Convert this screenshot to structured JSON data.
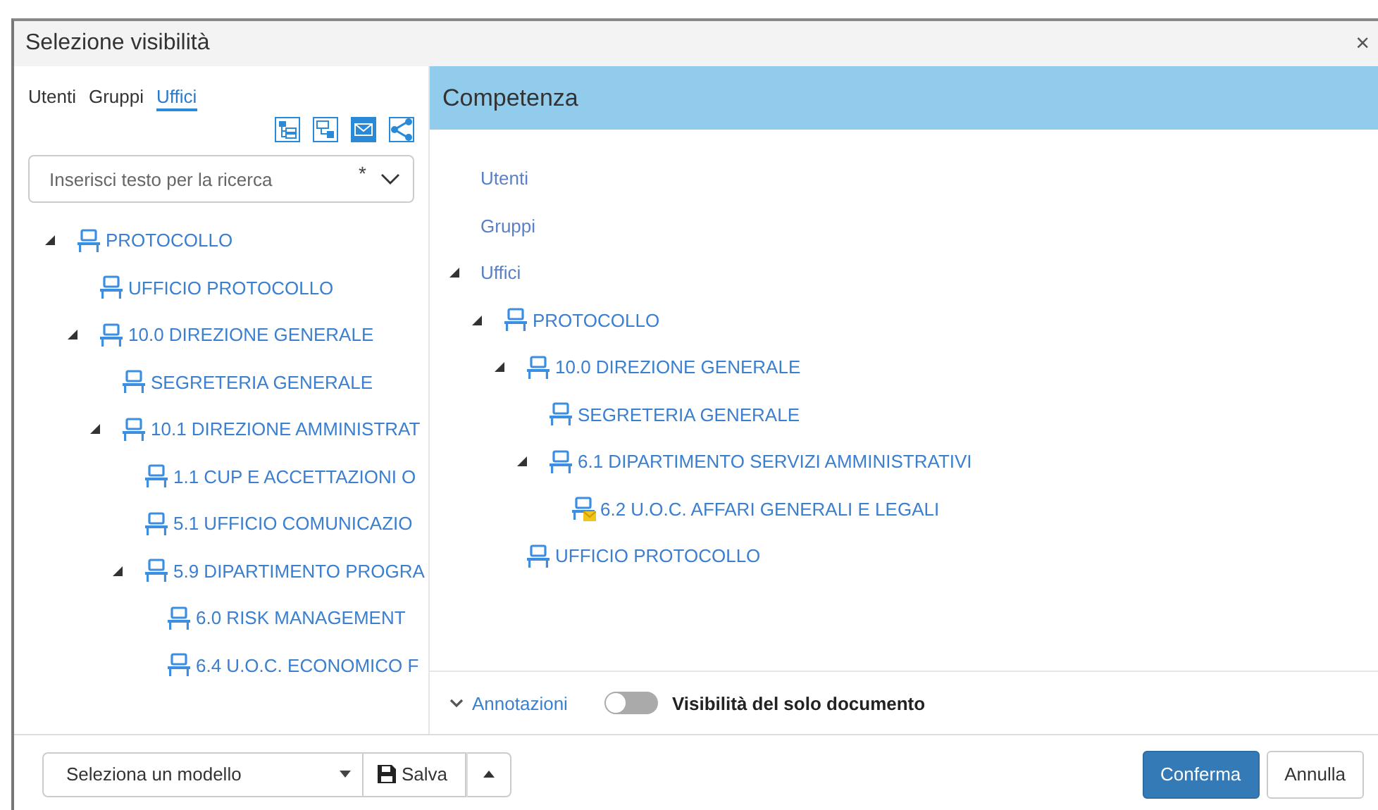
{
  "window": {
    "title": "Selezione visibilità",
    "close": "×"
  },
  "tabs": [
    {
      "label": "Utenti",
      "selected": false
    },
    {
      "label": "Gruppi",
      "selected": false
    },
    {
      "label": "Uffici",
      "selected": true
    }
  ],
  "search": {
    "placeholder": "Inserisci testo per la ricerca",
    "wildcard": "*"
  },
  "left_tree": [
    {
      "label": "PROTOCOLLO",
      "kind": "office",
      "expanded": true,
      "children": [
        {
          "label": "UFFICIO PROTOCOLLO",
          "kind": "office"
        },
        {
          "label": "10.0 DIREZIONE GENERALE",
          "kind": "office",
          "expanded": true,
          "children": [
            {
              "label": "SEGRETERIA GENERALE",
              "kind": "office"
            },
            {
              "label": "10.1 DIREZIONE AMMINISTRAT",
              "kind": "office",
              "expanded": true,
              "children": [
                {
                  "label": "1.1 CUP E ACCETTAZIONI O",
                  "kind": "office"
                },
                {
                  "label": "5.1 UFFICIO COMUNICAZIO",
                  "kind": "office"
                },
                {
                  "label": "5.9 DIPARTIMENTO PROGRA",
                  "kind": "office",
                  "expanded": true,
                  "children": [
                    {
                      "label": "6.0 RISK MANAGEMENT",
                      "kind": "office"
                    },
                    {
                      "label": "6.4 U.O.C. ECONOMICO F",
                      "kind": "office"
                    }
                  ]
                }
              ]
            }
          ]
        }
      ]
    }
  ],
  "panel": {
    "title": "Competenza"
  },
  "right_tree": [
    {
      "label": "Utenti",
      "kind": "category"
    },
    {
      "label": "Gruppi",
      "kind": "category"
    },
    {
      "label": "Uffici",
      "kind": "category",
      "expanded": true,
      "children": [
        {
          "label": "PROTOCOLLO",
          "kind": "office",
          "expanded": true,
          "children": [
            {
              "label": "10.0 DIREZIONE GENERALE",
              "kind": "office",
              "expanded": true,
              "children": [
                {
                  "label": "SEGRETERIA GENERALE",
                  "kind": "office"
                },
                {
                  "label": "6.1 DIPARTIMENTO SERVIZI AMMINISTRATIVI",
                  "kind": "office",
                  "expanded": true,
                  "children": [
                    {
                      "label": "6.2 U.O.C. AFFARI GENERALI E LEGALI",
                      "kind": "office-mail"
                    }
                  ]
                }
              ]
            },
            {
              "label": "UFFICIO PROTOCOLLO",
              "kind": "office"
            }
          ]
        }
      ]
    }
  ],
  "annotations": {
    "label": "Annotazioni"
  },
  "toggle": {
    "label": "Visibilità del solo documento",
    "on": false
  },
  "footer": {
    "model_placeholder": "Seleziona un modello",
    "save": "Salva",
    "confirm": "Conferma",
    "cancel": "Annulla"
  }
}
